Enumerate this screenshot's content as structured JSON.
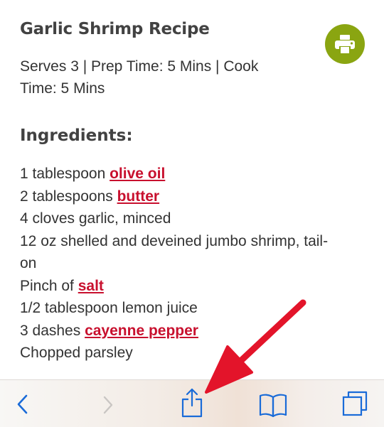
{
  "recipe": {
    "title": "Garlic Shrimp Recipe",
    "meta_line1": "Serves 3 | Prep Time: 5 Mins | Cook",
    "meta_line2": "Time: 5 Mins",
    "ingredients_heading": "Ingredients:",
    "ingredients": [
      {
        "text": "1 tablespoon ",
        "link": "olive oil"
      },
      {
        "text": "2 tablespoons ",
        "link": "butter"
      },
      {
        "text": "4 cloves garlic, minced"
      },
      {
        "text": "12 oz shelled and deveined jumbo shrimp, tail-"
      },
      {
        "text": "on"
      },
      {
        "text": "Pinch of ",
        "link": "salt"
      },
      {
        "text": "1/2 tablespoon lemon juice"
      },
      {
        "text": "3 dashes ",
        "link": "cayenne pepper"
      },
      {
        "text": "Chopped parsley"
      }
    ]
  },
  "print_button": {
    "icon": "printer-icon",
    "color": "#8aa511"
  },
  "toolbar": {
    "buttons": [
      {
        "name": "back",
        "icon": "chevron-left-icon",
        "enabled": true
      },
      {
        "name": "forward",
        "icon": "chevron-right-icon",
        "enabled": false
      },
      {
        "name": "share",
        "icon": "share-icon",
        "enabled": true
      },
      {
        "name": "bookmarks",
        "icon": "book-icon",
        "enabled": true
      },
      {
        "name": "tabs",
        "icon": "tabs-icon",
        "enabled": true
      }
    ],
    "tint_color": "#1a6bd8"
  },
  "annotation": {
    "arrow_color": "#e3142a",
    "points_to": "share-button"
  },
  "link_color": "#c8102e"
}
